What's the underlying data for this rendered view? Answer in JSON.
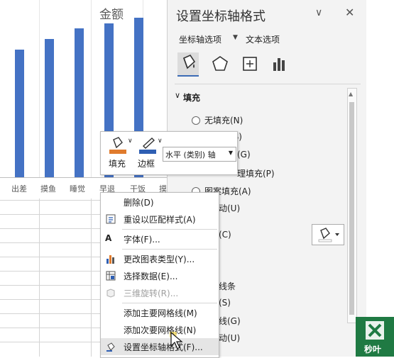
{
  "chart": {
    "title": "金额",
    "x_categories": [
      "出差",
      "摸鱼",
      "睡觉",
      "早退",
      "干饭",
      "摸"
    ]
  },
  "chart_data": {
    "type": "bar",
    "title": "金额",
    "categories": [
      "出差",
      "摸鱼",
      "睡觉",
      "早退",
      "干饭"
    ],
    "values": [
      72,
      78,
      84,
      87,
      90
    ],
    "bar_color": "#4472c4"
  },
  "pane": {
    "title": "设置坐标轴格式",
    "tabs": [
      {
        "label": "坐标轴选项",
        "active": true
      },
      {
        "label": "文本选项",
        "active": false
      }
    ],
    "section": "填充",
    "fill_options": [
      "无填充(N)",
      "(S)",
      "(G)",
      "理填充(P)",
      "图案填充(A)",
      "动(U)"
    ],
    "line_options": [
      "(C)",
      "线条",
      "(S)",
      "线(G)",
      "动(U)"
    ]
  },
  "mini_toolbar": {
    "fill_label": "填充",
    "border_label": "边框",
    "select_value": "水平 (类别) 轴"
  },
  "context_menu": {
    "items": [
      {
        "label": "删除(D)",
        "disabled": false
      },
      {
        "label": "重设以匹配样式(A)",
        "disabled": false
      },
      {
        "label": "字体(F)...",
        "disabled": false
      },
      {
        "label": "更改图表类型(Y)...",
        "disabled": false
      },
      {
        "label": "选择数据(E)...",
        "disabled": false
      },
      {
        "label": "三维旋转(R)...",
        "disabled": true
      },
      {
        "label": "添加主要网格线(M)",
        "disabled": false
      },
      {
        "label": "添加次要网格线(N)",
        "disabled": false
      },
      {
        "label": "设置坐标轴格式(F)...",
        "disabled": false
      }
    ]
  },
  "logo": {
    "text": "秒叶"
  },
  "colors": {
    "accent": "#4472c4",
    "pane_bg": "#f3f3f3",
    "excel_green": "#1f7a43"
  }
}
